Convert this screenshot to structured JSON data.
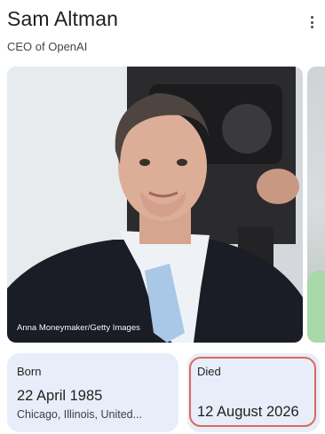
{
  "header": {
    "title": "Sam Altman",
    "subtitle": "CEO of OpenAI"
  },
  "media": {
    "photo_credit": "Anna Moneymaker/Getty Images"
  },
  "facts": {
    "born": {
      "label": "Born",
      "date": "22 April 1985",
      "place": "Chicago, Illinois, United..."
    },
    "died": {
      "label": "Died",
      "date": "12 August 2026"
    }
  },
  "icons": {
    "more": "more-vertical-icon"
  },
  "colors": {
    "card_background": "#e8eef9",
    "highlight_outline": "#d86a5d"
  }
}
